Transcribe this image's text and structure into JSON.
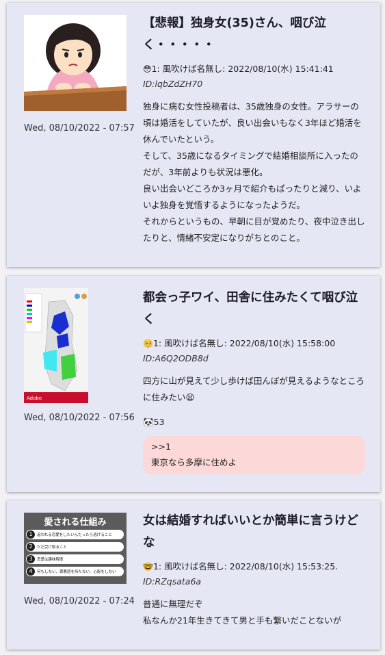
{
  "posts": [
    {
      "title": "【悲報】独身女(35)さん、咽び泣く・・・・・",
      "date": "Wed, 08/10/2022 - 07:57",
      "meta_line": "1: 風吹けば名無し: 2022/08/10(水) 15:41:41",
      "meta_id": "ID:lqbZdZH70",
      "emoji": "😳",
      "paragraphs": [
        "独身に病む女性投稿者は、35歳独身の女性。アラサーの頃は婚活をしていたが、良い出会いもなく3年ほど婚活を休んでいたという。",
        "そして、35歳になるタイミングで結婚相談所に入ったのだが、3年前よりも状況は悪化。",
        "良い出会いどころか3ヶ月で紹介もぱったりと減り、いよいよ独身を覚悟するようになったようだ。",
        "それからというもの、早朝に目が覚めたり、夜中泣き出したりと、情緒不安定になりがちとのこと。"
      ]
    },
    {
      "title": "都会っ子ワイ、田舎に住みたくて咽び泣く",
      "date": "Wed, 08/10/2022 - 07:56",
      "meta_line": "1: 風吹けば名無し: 2022/08/10(水) 15:58:00",
      "meta_id": "ID:A6Q2ODB8d",
      "emoji": "🥺",
      "paragraphs": [
        "四方に山が見えて少し歩けば田んぼが見えるようなところに住みたい😫"
      ],
      "count_line": "🐼53",
      "reply": {
        "ref": ">>1",
        "text": "東京なら多摩に住めよ"
      },
      "map_footer": "Adobe"
    },
    {
      "title": "女は結婚すればいいとか簡単に言うけどな",
      "date": "Wed, 08/10/2022 - 07:24",
      "meta_line": "1: 風吹けば名無し: 2022/08/10(水) 15:53:25.",
      "meta_id": "ID:RZqsata6a",
      "emoji": "🤓",
      "paragraphs": [
        "普通に無理だぞ",
        "私なんか21年生きてきて男と手も繋いだことないが"
      ],
      "infographic": {
        "heading": "愛される仕組み",
        "items": [
          {
            "num": "1",
            "text": "追われる恋愛をしたいんだったら逃げること"
          },
          {
            "num": "2",
            "text": "ただ受け取ること"
          },
          {
            "num": "3",
            "text": "恋愛は趣味程度"
          },
          {
            "num": "4",
            "text": "何もしない、罪悪感を持たない、心配をしない"
          }
        ]
      }
    }
  ]
}
